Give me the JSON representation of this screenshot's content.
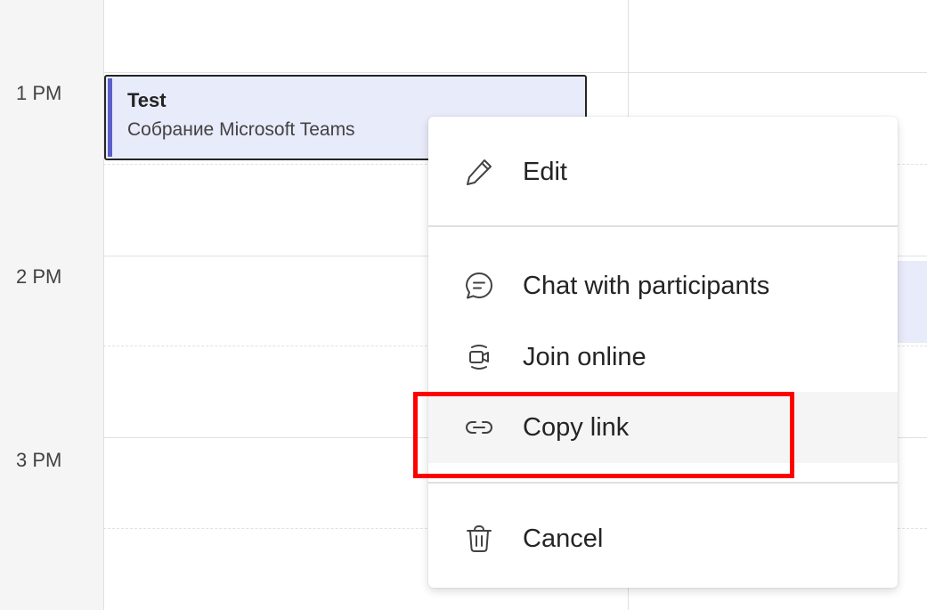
{
  "times": {
    "t1": "1 PM",
    "t2": "2 PM",
    "t3": "3 PM"
  },
  "event": {
    "title": "Test",
    "subtitle": "Собрание Microsoft Teams"
  },
  "menu": {
    "edit": "Edit",
    "chat": "Chat with participants",
    "join": "Join online",
    "copy_link": "Copy link",
    "cancel": "Cancel"
  },
  "colors": {
    "accent": "#5b5fc7",
    "event_bg": "#e8ebfa",
    "highlight": "#ff0000"
  }
}
